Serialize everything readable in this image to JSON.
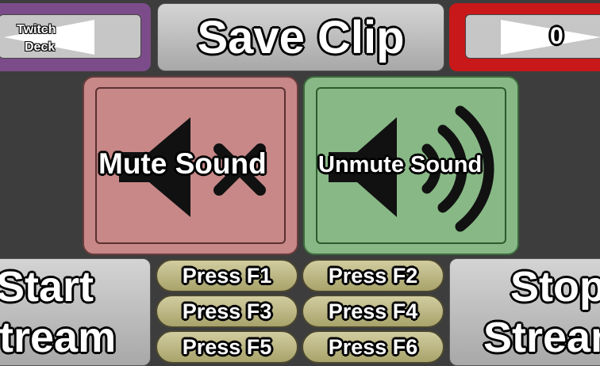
{
  "top_bar": {
    "twitch_deck_label_line1": "Twitch",
    "twitch_deck_label_line2": "Deck",
    "save_clip_label": "Save Clip",
    "counter_value": "0"
  },
  "sound": {
    "mute_label": "Mute Sound",
    "unmute_label": "Unmute Sound"
  },
  "stream": {
    "start_line1": "Start",
    "start_line2": "Stream",
    "stop_line1": "Stop",
    "stop_line2": "Stream"
  },
  "fkeys": [
    "Press F1",
    "Press F2",
    "Press F3",
    "Press F4",
    "Press F5",
    "Press F6"
  ],
  "colors": {
    "background": "#3d3d3d",
    "purple_frame": "#7c4c8a",
    "red_frame": "#c8181a",
    "mute_tile": "#c88888",
    "unmute_tile": "#88b886",
    "fkey_pill": "#c0ba88"
  },
  "icons": {
    "mute": "speaker-muted-icon",
    "unmute": "speaker-loud-icon",
    "back": "arrow-left-icon",
    "forward": "arrow-right-icon"
  }
}
